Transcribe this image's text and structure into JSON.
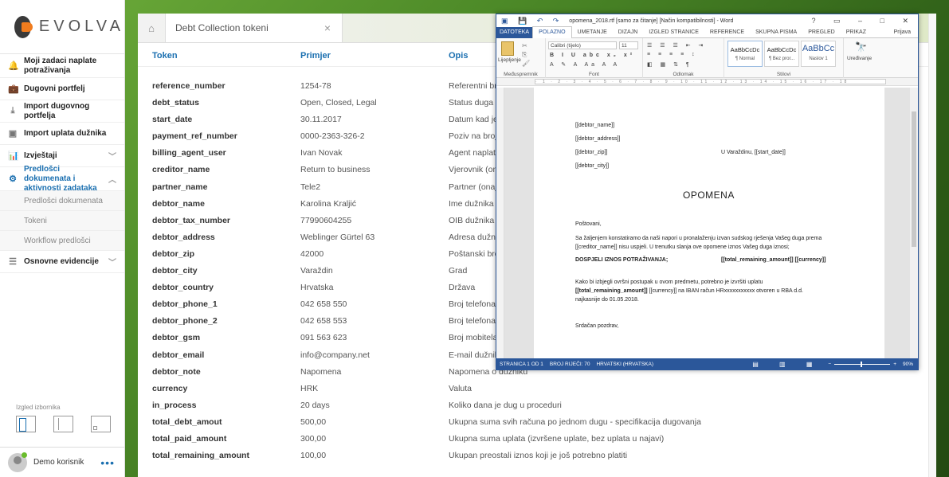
{
  "sidebar": {
    "logo_text": "EVOLVA",
    "items": [
      {
        "label": "Moji zadaci naplate potraživanja",
        "icon": "bell-icon",
        "glyph": "🔔"
      },
      {
        "label": "Dugovni portfelj",
        "icon": "briefcase-icon",
        "glyph": "💼"
      },
      {
        "label": "Import dugovnog portfelja",
        "icon": "download-icon",
        "glyph": "⤓"
      },
      {
        "label": "Import uplata dužnika",
        "icon": "money-icon",
        "glyph": "▣"
      },
      {
        "label": "Izvještaji",
        "icon": "bar-chart-icon",
        "glyph": "📊"
      },
      {
        "label": "Predlošci dokumenata i aktivnosti zadataka",
        "icon": "gear-icon",
        "glyph": "⚙"
      }
    ],
    "subitems": [
      "Predlošci dokumenata",
      "Tokeni",
      "Workflow predlošci"
    ],
    "bottom_item": {
      "label": "Osnovne evidencije",
      "icon": "list-icon",
      "glyph": "☰"
    },
    "layout_label": "Izgled izbornika",
    "user_name": "Demo korisnik"
  },
  "main": {
    "tab_title": "Debt Collection tokeni",
    "columns": [
      "Token",
      "Primjer",
      "Opis"
    ],
    "rows": [
      [
        "reference_number",
        "1254-78",
        "Referentni broj"
      ],
      [
        "debt_status",
        "Open, Closed, Legal",
        "Status duga"
      ],
      [
        "start_date",
        "30.11.2017",
        "Datum kad je d"
      ],
      [
        "payment_ref_number",
        "0000-2363-326-2",
        "Poziv na broj"
      ],
      [
        "billing_agent_user",
        "Ivan Novak",
        "Agent naplate"
      ],
      [
        "creditor_name",
        "Return to business",
        "Vjerovnik (ona"
      ],
      [
        "partner_name",
        "Tele2",
        "Partner (onaj t"
      ],
      [
        "debtor_name",
        "Karolina Kraljić",
        "Ime dužnika"
      ],
      [
        "debtor_tax_number",
        "77990604255",
        "OIB dužnika"
      ],
      [
        "debtor_address",
        "Weblinger Gürtel 63",
        "Adresa dužnik"
      ],
      [
        "debtor_zip",
        "42000",
        "Poštanski broj"
      ],
      [
        "debtor_city",
        "Varaždin",
        "Grad"
      ],
      [
        "debtor_country",
        "Hrvatska",
        "Država"
      ],
      [
        "debtor_phone_1",
        "042 658 550",
        "Broj telefona d"
      ],
      [
        "debtor_phone_2",
        "042 658 553",
        "Broj telefona d"
      ],
      [
        "debtor_gsm",
        "091 563 623",
        "Broj mobitela d"
      ],
      [
        "debtor_email",
        "info@company.net",
        "E-mail dužnika"
      ],
      [
        "debtor_note",
        "Napomena",
        "Napomena o dužniku"
      ],
      [
        "currency",
        "HRK",
        "Valuta"
      ],
      [
        "in_process",
        "20 days",
        "Koliko dana je dug u proceduri"
      ],
      [
        "total_debt_amout",
        "500,00",
        "Ukupna suma svih računa po jednom dugu - specifikacija dugovanja"
      ],
      [
        "total_paid_amount",
        "300,00",
        "Ukupna suma uplata (izvršene uplate, bez uplata u najavi)"
      ],
      [
        "total_remaining_amount",
        "100,00",
        "Ukupan preostali iznos koji je još potrebno platiti"
      ]
    ]
  },
  "word": {
    "title": "opomena_2018.rtf [samo za čitanje] [Način kompatibilnosti] - Word",
    "tabs": [
      "DATOTEKA",
      "POLAZNO",
      "UMETANJE",
      "DIZAJN",
      "IZGLED STRANICE",
      "REFERENCE",
      "SKUPNA PISMA",
      "PREGLED",
      "PRIKAZ"
    ],
    "tab_right": "Prijava",
    "ribbon": {
      "paste": "Lijepljenje",
      "font_name": "Calibri (tijelo)",
      "font_size": "11",
      "groups": [
        "Međuspremnik",
        "Font",
        "Odlomak",
        "Stilovi",
        "Uređivanje"
      ],
      "styles": [
        {
          "sample": "AaBbCcDc",
          "name": "¶ Normal"
        },
        {
          "sample": "AaBbCcDc",
          "name": "¶ Bez pror..."
        },
        {
          "sample": "AaBbCc",
          "name": "Naslov 1"
        }
      ],
      "editing": "Uređivanje"
    },
    "doc": {
      "line1": "[[debtor_name]]",
      "line2": "[[debtor_address]]",
      "line3": "[[debtor_zip]]",
      "line3_right": "U Varaždinu, [[start_date]]",
      "line4": "[[debtor_city]]",
      "heading": "OPOMENA",
      "greeting": "Poštovani,",
      "p1a": "Sa žaljenjem konstatiramo da naši napori u pronalaženju izvan sudskog rješenja Vašeg duga prema",
      "p1b": "[[creditor_name]] nisu uspjeli. U trenutku slanja ove opomene iznos Vašeg duga iznosi;",
      "due_label": "DOSPJELI IZNOS POTRAŽIVANJA;",
      "due_value": "[[total_remaining_amount]] [[currency]]",
      "p2a": "Kako bi izbjegli ovršni postupak u ovom predmetu, potrebno je izvršiti uplatu",
      "p2b_bold": "[[total_remaining_amount]]",
      "p2b_rest": " [[currency]]  na IBAN račun HRxxxxxxxxxxx  otvoren u RBA d.d.",
      "p2c": "najkasnije do 01.05.2018.",
      "closing": "Srdačan pozdrav,"
    },
    "status": {
      "page": "STRANICA 1 OD 1",
      "words": "BROJ RIJEČI: 70",
      "lang": "HRVATSKI (HRVATSKA)",
      "zoom": "90%"
    }
  }
}
